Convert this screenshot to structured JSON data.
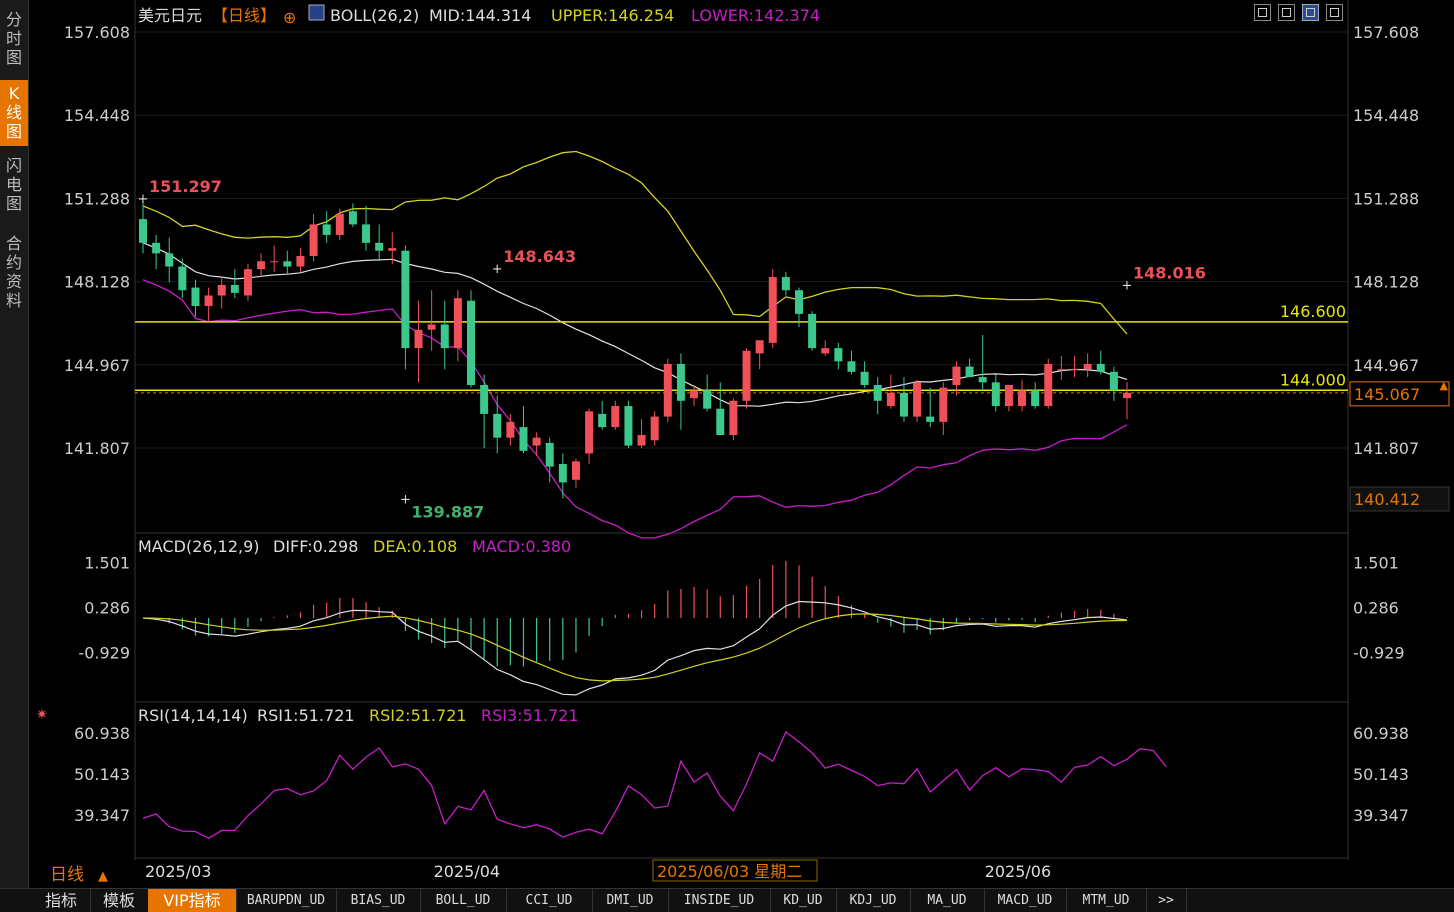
{
  "sidebar": {
    "tabs": [
      {
        "label": "分时图",
        "active": false
      },
      {
        "label": "K线图",
        "active": true
      },
      {
        "label": "闪电图",
        "active": false
      },
      {
        "label": "合约资料",
        "active": false
      }
    ]
  },
  "header": {
    "title": "美元日元",
    "period_tag": "【日线】",
    "boll_label": "BOLL(26,2)",
    "boll_mid": "MID:144.314",
    "boll_upper": "UPPER:146.254",
    "boll_lower": "LOWER:142.374"
  },
  "macd_header": {
    "label": "MACD(26,12,9)",
    "diff": "DIFF:0.298",
    "dea": "DEA:0.108",
    "macd": "MACD:0.380"
  },
  "rsi_header": {
    "label": "RSI(14,14,14)",
    "rsi1": "RSI1:51.721",
    "rsi2": "RSI2:51.721",
    "rsi3": "RSI3:51.721"
  },
  "footer": {
    "period": "日线",
    "date_readout": "2025/06/03 星期二",
    "x_labels": [
      {
        "label": "2025/03",
        "index": 0
      },
      {
        "label": "2025/04",
        "index": 22
      },
      {
        "label": "2025/06",
        "index": 64
      }
    ]
  },
  "bottom_tabs": [
    {
      "label": "指标",
      "active": false
    },
    {
      "label": "模板",
      "active": false
    },
    {
      "label": "VIP指标",
      "active": true
    },
    {
      "label": "BARUPDN_UD",
      "active": false
    },
    {
      "label": "BIAS_UD",
      "active": false
    },
    {
      "label": "BOLL_UD",
      "active": false
    },
    {
      "label": "CCI_UD",
      "active": false
    },
    {
      "label": "DMI_UD",
      "active": false
    },
    {
      "label": "INSIDE_UD",
      "active": false
    },
    {
      "label": "KD_UD",
      "active": false
    },
    {
      "label": "KDJ_UD",
      "active": false
    },
    {
      "label": "MA_UD",
      "active": false
    },
    {
      "label": "MACD_UD",
      "active": false
    },
    {
      "label": "MTM_UD",
      "active": false
    },
    {
      "label": ">>",
      "active": false
    }
  ],
  "colors": {
    "up": "#f0505a",
    "down": "#3cc88c",
    "mid": "#e0e0e0",
    "upper": "#d2d21e",
    "lower": "#c81ec8",
    "level": "#e6e600",
    "accent": "#e87400",
    "annot_high": "#e8505a",
    "annot_low": "#40b070"
  },
  "chart_data": {
    "type": "candlestick",
    "price_axis": {
      "ticks": [
        "157.608",
        "154.448",
        "151.288",
        "148.128",
        "144.967",
        "141.807"
      ],
      "range": [
        137.5,
        158.5
      ]
    },
    "price_tags": {
      "current": "145.067",
      "lower_tag": "140.412"
    },
    "horizontal_levels": [
      {
        "label": "146.600",
        "value": 146.6
      },
      {
        "label": "144.000",
        "value": 144.0
      }
    ],
    "annotations": [
      {
        "label": "151.297",
        "index": 0,
        "value": 151.297,
        "kind": "high"
      },
      {
        "label": "148.643",
        "index": 27,
        "value": 148.643,
        "kind": "high"
      },
      {
        "label": "148.016",
        "index": 75,
        "value": 148.016,
        "kind": "high"
      },
      {
        "label": "139.887",
        "index": 20,
        "value": 139.887,
        "kind": "low"
      }
    ],
    "candles": [
      [
        150.5,
        151.3,
        149.2,
        149.6
      ],
      [
        149.6,
        149.9,
        148.6,
        149.2
      ],
      [
        149.2,
        149.8,
        148.1,
        148.7
      ],
      [
        148.7,
        149.0,
        147.5,
        147.8
      ],
      [
        147.9,
        148.2,
        146.8,
        147.2
      ],
      [
        147.2,
        147.9,
        146.6,
        147.6
      ],
      [
        147.6,
        148.3,
        147.1,
        148.0
      ],
      [
        148.0,
        148.6,
        147.5,
        147.7
      ],
      [
        147.6,
        148.8,
        147.4,
        148.6
      ],
      [
        148.6,
        149.2,
        148.3,
        148.9
      ],
      [
        148.9,
        149.5,
        148.5,
        148.9
      ],
      [
        148.9,
        149.3,
        148.4,
        148.7
      ],
      [
        148.7,
        149.4,
        148.5,
        149.1
      ],
      [
        149.1,
        150.7,
        148.9,
        150.3
      ],
      [
        150.3,
        150.8,
        149.6,
        149.9
      ],
      [
        149.9,
        150.9,
        149.7,
        150.7
      ],
      [
        150.8,
        151.1,
        150.2,
        150.3
      ],
      [
        150.3,
        151.0,
        149.3,
        149.6
      ],
      [
        149.6,
        150.3,
        148.9,
        149.3
      ],
      [
        149.3,
        150.0,
        148.8,
        149.4
      ],
      [
        149.3,
        149.5,
        144.8,
        145.6
      ],
      [
        145.6,
        147.4,
        144.3,
        146.3
      ],
      [
        146.3,
        147.8,
        145.5,
        146.5
      ],
      [
        146.5,
        147.4,
        144.8,
        145.6
      ],
      [
        145.6,
        147.8,
        145.1,
        147.5
      ],
      [
        147.4,
        147.8,
        144.1,
        144.2
      ],
      [
        144.2,
        144.6,
        141.8,
        143.1
      ],
      [
        143.1,
        143.8,
        141.6,
        142.2
      ],
      [
        142.2,
        143.1,
        141.9,
        142.8
      ],
      [
        142.6,
        143.4,
        141.6,
        141.7
      ],
      [
        141.9,
        142.4,
        141.5,
        142.2
      ],
      [
        142.0,
        142.2,
        140.5,
        141.1
      ],
      [
        141.2,
        141.6,
        139.9,
        140.5
      ],
      [
        140.6,
        141.4,
        140.3,
        141.3
      ],
      [
        141.6,
        143.3,
        141.2,
        143.2
      ],
      [
        143.1,
        143.6,
        142.5,
        142.6
      ],
      [
        142.6,
        143.6,
        142.5,
        143.4
      ],
      [
        143.4,
        143.6,
        141.8,
        141.9
      ],
      [
        141.9,
        142.9,
        141.8,
        142.3
      ],
      [
        142.1,
        143.2,
        141.9,
        143.0
      ],
      [
        143.0,
        145.2,
        142.8,
        145.0
      ],
      [
        145.0,
        145.4,
        142.5,
        143.6
      ],
      [
        143.7,
        144.2,
        143.4,
        144.0
      ],
      [
        144.0,
        144.6,
        143.2,
        143.3
      ],
      [
        143.3,
        144.3,
        142.3,
        142.3
      ],
      [
        142.3,
        143.7,
        142.1,
        143.6
      ],
      [
        143.6,
        145.6,
        143.3,
        145.5
      ],
      [
        145.4,
        145.9,
        144.8,
        145.9
      ],
      [
        145.8,
        148.6,
        145.6,
        148.3
      ],
      [
        148.3,
        148.5,
        147.6,
        147.8
      ],
      [
        147.8,
        147.9,
        146.4,
        146.9
      ],
      [
        146.9,
        147.0,
        145.5,
        145.6
      ],
      [
        145.4,
        145.9,
        145.3,
        145.6
      ],
      [
        145.6,
        145.8,
        144.8,
        145.1
      ],
      [
        145.1,
        145.5,
        144.6,
        144.7
      ],
      [
        144.7,
        145.1,
        144.1,
        144.2
      ],
      [
        144.2,
        144.5,
        143.1,
        143.6
      ],
      [
        143.4,
        144.6,
        143.3,
        143.9
      ],
      [
        143.9,
        144.5,
        142.8,
        143.0
      ],
      [
        143.0,
        144.4,
        142.8,
        144.3
      ],
      [
        143.0,
        144.1,
        142.6,
        142.8
      ],
      [
        142.8,
        144.3,
        142.3,
        144.1
      ],
      [
        144.2,
        145.1,
        143.8,
        144.9
      ],
      [
        144.9,
        145.2,
        144.5,
        144.5
      ],
      [
        144.5,
        146.1,
        144.0,
        144.3
      ],
      [
        144.3,
        144.6,
        143.2,
        143.4
      ],
      [
        143.4,
        144.2,
        143.2,
        144.2
      ],
      [
        143.4,
        144.4,
        143.2,
        144.0
      ],
      [
        144.0,
        144.3,
        143.3,
        143.4
      ],
      [
        143.4,
        145.2,
        143.3,
        145.0
      ],
      [
        144.8,
        145.3,
        144.4,
        144.8
      ],
      [
        144.8,
        145.3,
        144.5,
        144.8
      ],
      [
        144.8,
        145.4,
        144.5,
        145.0
      ],
      [
        145.0,
        145.5,
        144.6,
        144.7
      ],
      [
        144.7,
        144.9,
        143.6,
        144.0
      ],
      [
        143.7,
        144.3,
        142.9,
        143.9
      ]
    ],
    "macd": {
      "ticks": [
        "1.501",
        "0.286",
        "-0.929"
      ],
      "range": [
        -2.0,
        2.0
      ],
      "diff_series_name": "DIFF",
      "dea_series_name": "DEA",
      "macd_series_name": "MACD"
    },
    "rsi": {
      "ticks": [
        "60.938",
        "50.143",
        "39.347"
      ],
      "range": [
        30.0,
        65.0
      ],
      "values": [
        38.5,
        39.6,
        36.3,
        35.1,
        35.0,
        33.2,
        35.3,
        35.3,
        39.2,
        42.3,
        45.8,
        46.3,
        44.7,
        45.7,
        48.4,
        55.1,
        51.4,
        54.6,
        57.0,
        52.0,
        52.8,
        51.4,
        47.1,
        37.0,
        41.6,
        40.7,
        45.8,
        38.2,
        37.0,
        36.0,
        36.8,
        35.7,
        33.5,
        34.8,
        35.6,
        34.4,
        40.2,
        47.0,
        44.7,
        41.2,
        41.7,
        53.5,
        48.0,
        50.4,
        44.3,
        40.5,
        47.5,
        55.7,
        53.5,
        61.2,
        58.6,
        55.7,
        51.7,
        52.7,
        51.1,
        49.5,
        47.1,
        47.8,
        47.6,
        51.5,
        45.4,
        48.4,
        51.3,
        45.9,
        49.7,
        51.8,
        49.4,
        51.5,
        51.3,
        50.8,
        48.0,
        51.9,
        52.5,
        54.7,
        52.3,
        54.0,
        56.8,
        56.3,
        52.0
      ]
    }
  }
}
